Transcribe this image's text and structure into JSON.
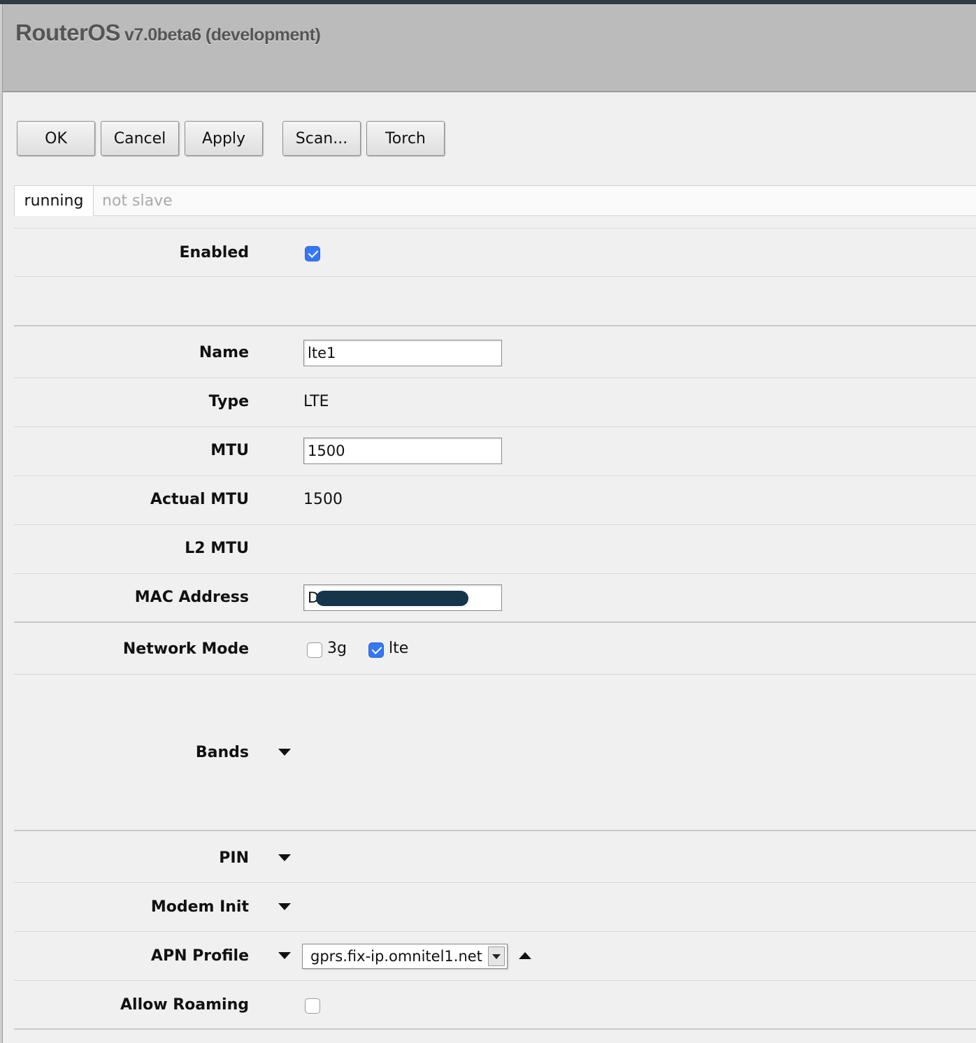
{
  "header": {
    "brand": "RouterOS",
    "version": "v7.0beta6 (development)"
  },
  "toolbar": {
    "ok": "OK",
    "cancel": "Cancel",
    "apply": "Apply",
    "scan": "Scan...",
    "torch": "Torch"
  },
  "status": {
    "running": "running",
    "slave": "not slave"
  },
  "form": {
    "enabled": {
      "label": "Enabled",
      "checked": true
    },
    "name": {
      "label": "Name",
      "value": "lte1"
    },
    "type": {
      "label": "Type",
      "value": "LTE"
    },
    "mtu": {
      "label": "MTU",
      "value": "1500"
    },
    "actual_mtu": {
      "label": "Actual MTU",
      "value": "1500"
    },
    "l2_mtu": {
      "label": "L2 MTU",
      "value": ""
    },
    "mac_address": {
      "label": "MAC Address",
      "value": "D"
    },
    "network_mode": {
      "label": "Network Mode",
      "options": [
        {
          "label": "3g",
          "checked": false
        },
        {
          "label": "lte",
          "checked": true
        }
      ]
    },
    "bands": {
      "label": "Bands"
    },
    "pin": {
      "label": "PIN"
    },
    "modem_init": {
      "label": "Modem Init"
    },
    "apn_profile": {
      "label": "APN Profile",
      "value": "gprs.fix-ip.omnitel1.net"
    },
    "allow_roaming": {
      "label": "Allow Roaming",
      "checked": false
    }
  },
  "icons": {
    "expand": "triangle-down-icon",
    "collapse": "triangle-up-icon",
    "dropdown": "chevron-down-icon",
    "check": "checkmark-icon"
  }
}
